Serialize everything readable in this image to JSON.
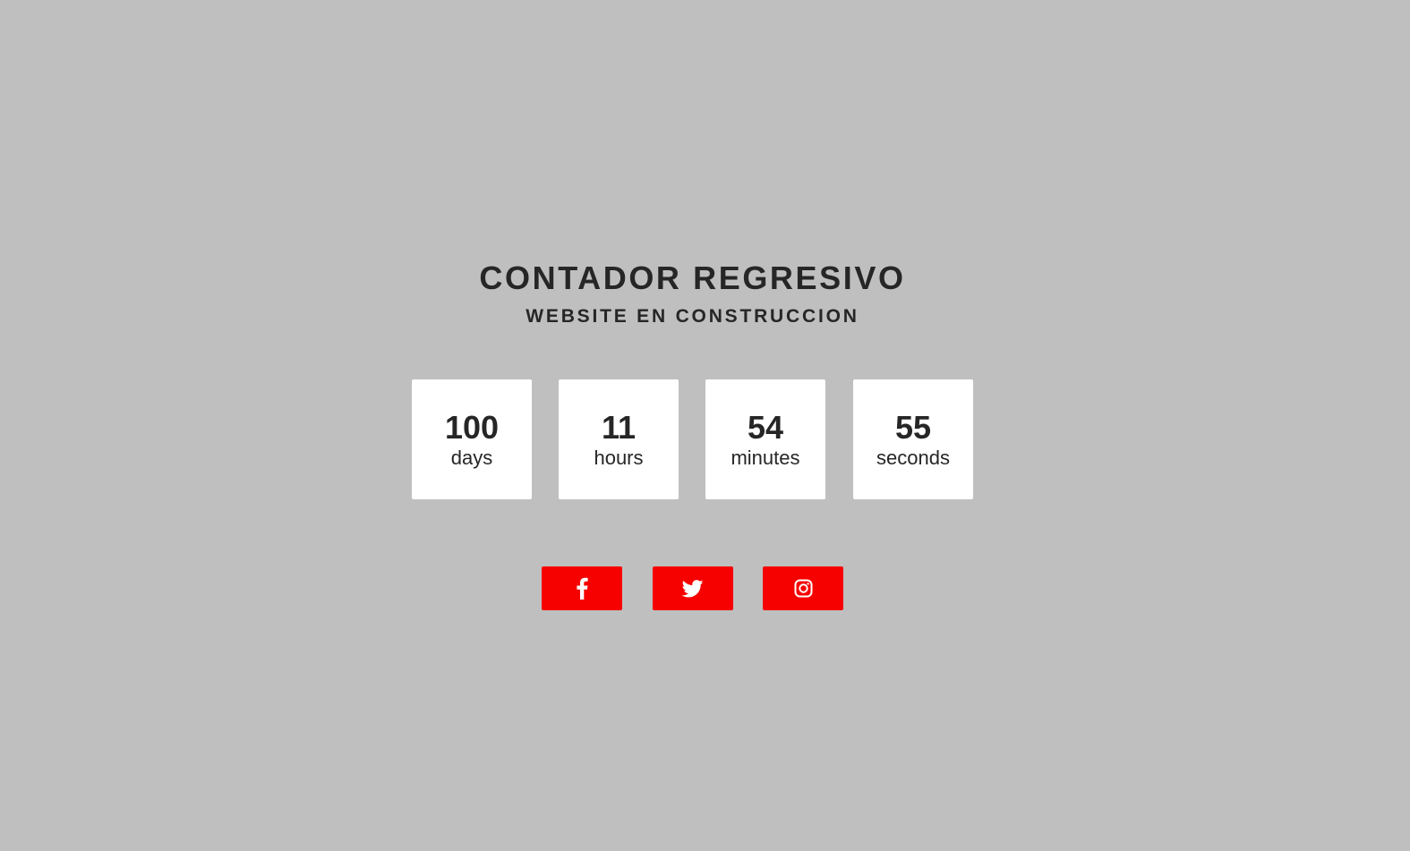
{
  "header": {
    "title": "CONTADOR REGRESIVO",
    "subtitle": "WEBSITE EN CONSTRUCCION"
  },
  "countdown": [
    {
      "value": "100",
      "unit": "days"
    },
    {
      "value": "11",
      "unit": "hours"
    },
    {
      "value": "54",
      "unit": "minutes"
    },
    {
      "value": "55",
      "unit": "seconds"
    }
  ],
  "socials": [
    {
      "icon": "facebook-icon"
    },
    {
      "icon": "twitter-icon"
    },
    {
      "icon": "instagram-icon"
    }
  ],
  "colors": {
    "background": "#bfbfbf",
    "text": "#262626",
    "card": "#ffffff",
    "accent": "#f70000"
  }
}
